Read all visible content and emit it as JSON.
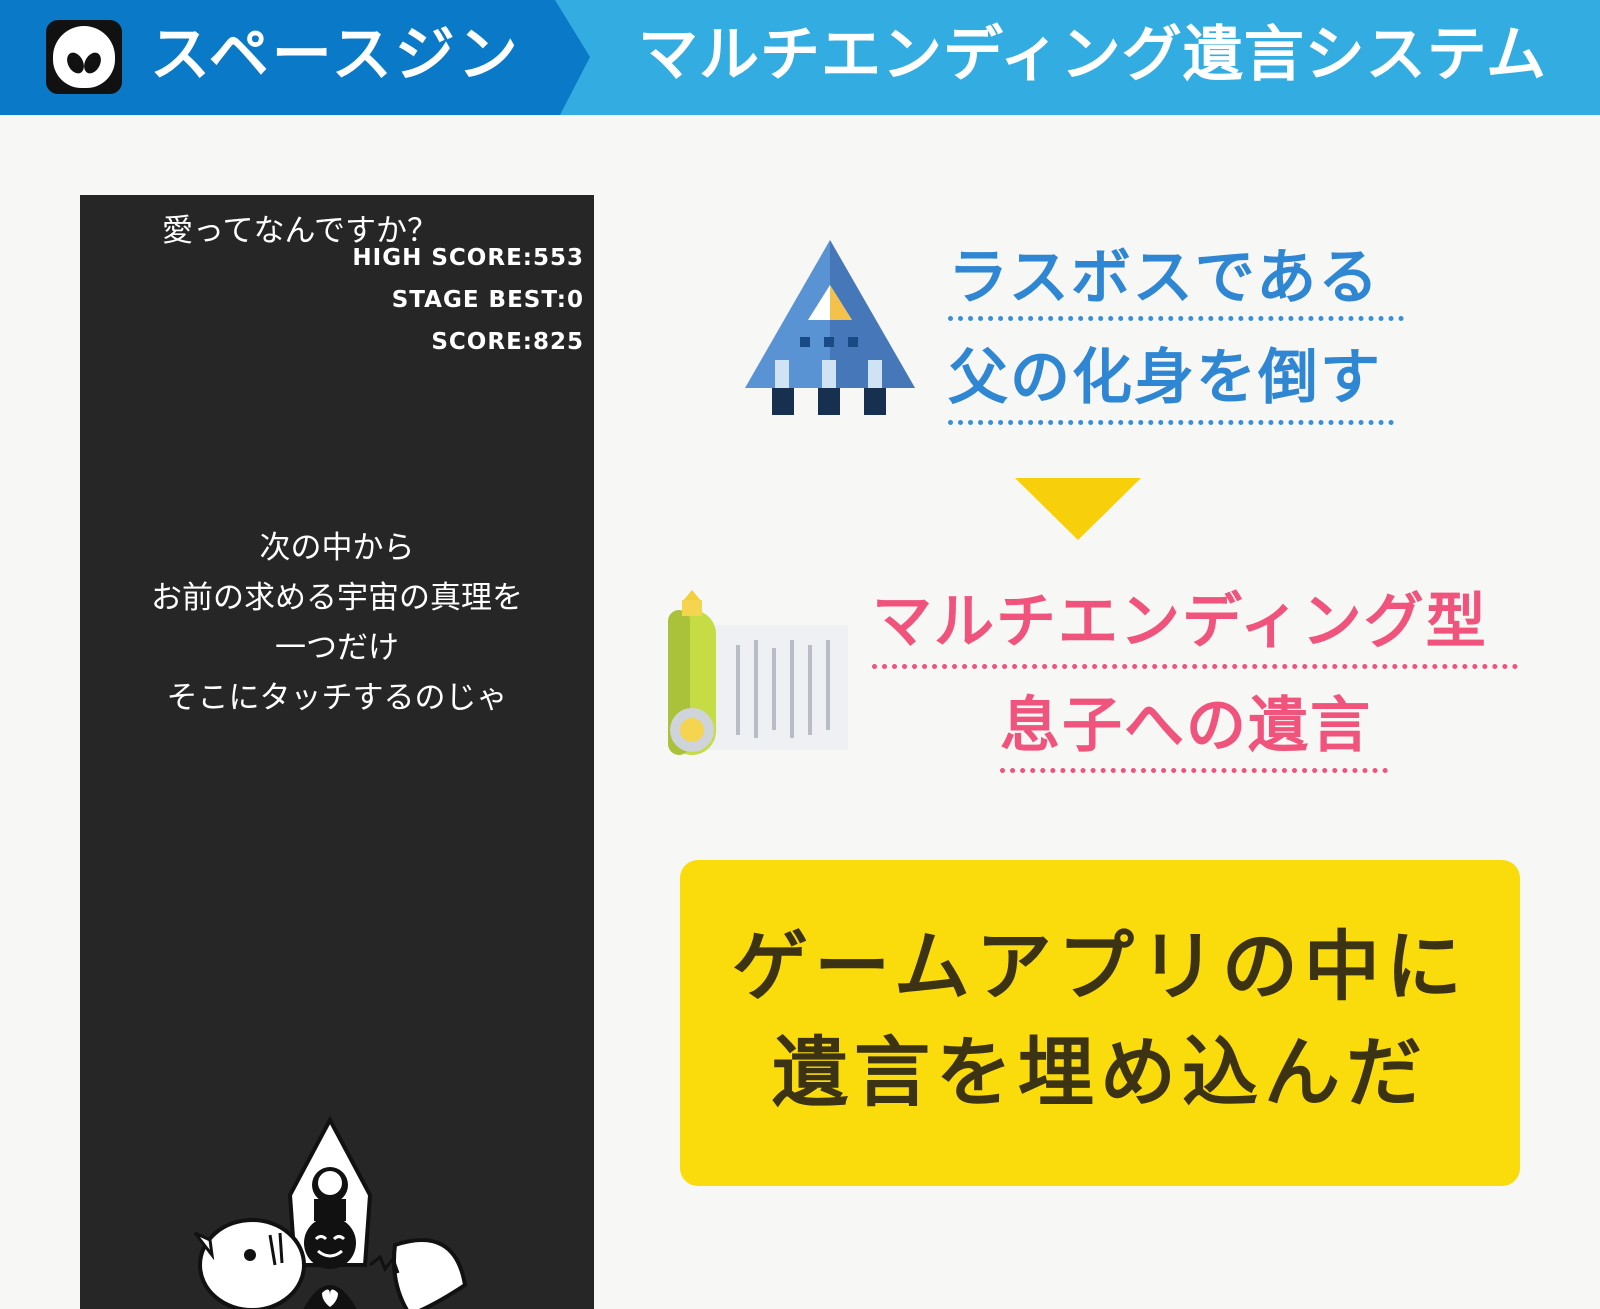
{
  "header": {
    "brand": "スペースジン",
    "title": "マルチエンディング遺言システム"
  },
  "game": {
    "question": "愛ってなんですか？",
    "high_score": "HIGH SCORE:553",
    "stage_best": "STAGE BEST:0",
    "score": "SCORE:825",
    "instructions": [
      "次の中から",
      "お前の求める宇宙の真理を",
      "一つだけ",
      "そこにタッチするのじゃ"
    ]
  },
  "boss_text": {
    "line1": "ラスボスである",
    "line2": "父の化身を倒す"
  },
  "will_text": {
    "line1": "マルチエンディング型",
    "line2": "息子への遺言"
  },
  "summary": {
    "line1": "ゲームアプリの中に",
    "line2": "遺言を埋め込んだ"
  },
  "colors": {
    "header_dark": "#0a7ac8",
    "header_light": "#33ace2",
    "blue_text": "#2f86d3",
    "pink_text": "#f0537c",
    "arrow": "#f7cf0a",
    "box": "#fadb0b"
  }
}
